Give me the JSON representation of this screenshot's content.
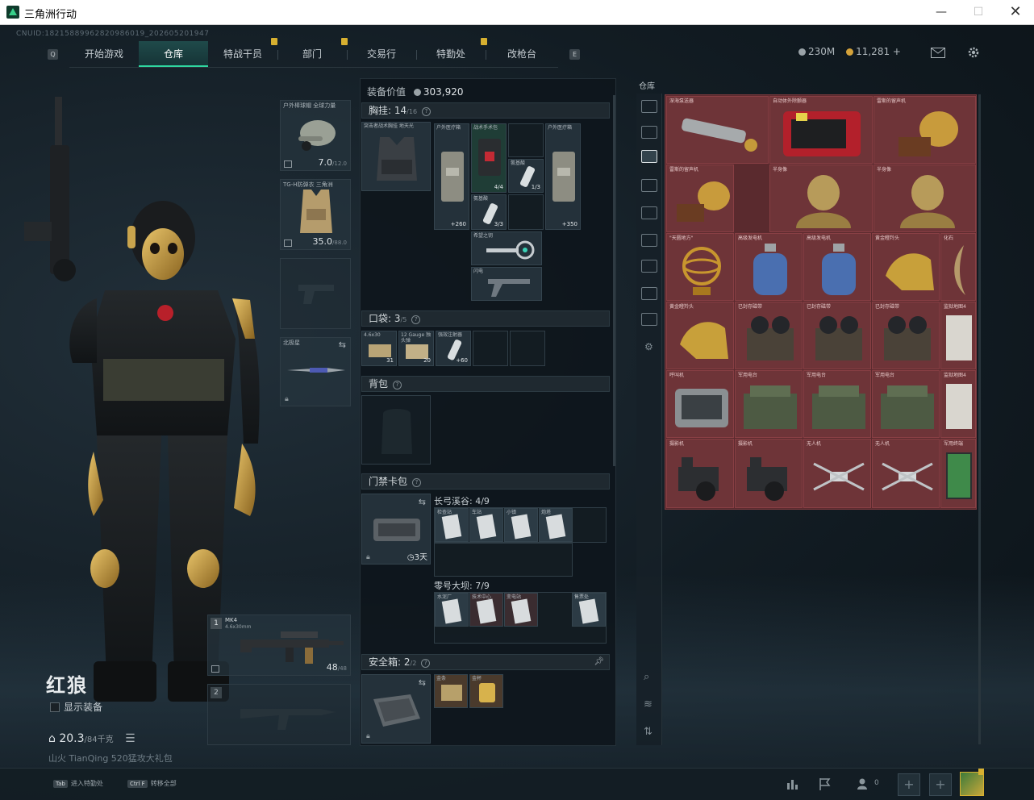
{
  "window": {
    "title": "三角洲行动"
  },
  "cnuid": "CNUID:18215889962820986019_202605201947",
  "nav": {
    "tabs": [
      "开始游戏",
      "仓库",
      "特战干员",
      "部门",
      "交易行",
      "特勤处",
      "改枪台"
    ],
    "active": "仓库",
    "left_key": "Q",
    "right_key": "E"
  },
  "currency": {
    "coins": "230M",
    "bonds": "11,281 +"
  },
  "colors": {
    "accent": "#2fd6a0",
    "stash_bg": "#5a2a2e",
    "badge": "#d7b030"
  },
  "operator": {
    "name": "红狼",
    "show_equipment": "显示装备",
    "weight": "20.3",
    "weight_max": "/84千克",
    "friend_line": "山火 TianQing 520猛攻大礼包"
  },
  "gear": {
    "helmet": {
      "name": "户外棒球帽 全球力量",
      "value": "7.0",
      "max": "/12.0"
    },
    "armor": {
      "name": "TG-H防弹衣 三角洲",
      "value": "35.0",
      "max": "/88.0"
    },
    "knife": {
      "name": "北极星"
    },
    "primary": {
      "name": "MK4",
      "caliber": "4.6x30mm",
      "ammo": "48",
      "ammo_max": "/48",
      "slot": "1"
    },
    "secondary": {
      "slot": "2"
    }
  },
  "mid": {
    "equip_value_label": "装备价值",
    "equip_value": "303,920",
    "chest": {
      "title": "胸挂:",
      "count": "14",
      "max": "/16",
      "rig": "突击者战术胸挂 地天光"
    },
    "chest_items": [
      {
        "label": "户外医疗箱",
        "val": "+260"
      },
      {
        "label": "战术手术包",
        "val": "4/4"
      },
      {
        "label": "氨基酸",
        "val": "1/3"
      },
      {
        "label": "户外医疗箱",
        "val": "+350"
      },
      {
        "label": "氨基酸",
        "val": "3/3"
      },
      {
        "label": "希望之钥",
        "val": ""
      },
      {
        "label": "闪电",
        "val": ""
      }
    ],
    "pocket": {
      "title": "口袋:",
      "count": "3",
      "max": "/5"
    },
    "pocket_items": [
      {
        "label": "4.6x30",
        "val": "31"
      },
      {
        "label": "12 Gauge 独头弹",
        "val": "20"
      },
      {
        "label": "强效注射器",
        "val": "+60"
      }
    ],
    "backpack": {
      "title": "背包"
    },
    "keycard": {
      "title": "门禁卡包",
      "days": "3天"
    },
    "keys_zones": [
      {
        "name": "长弓溪谷:",
        "count": "4/9",
        "items": [
          "检查站",
          "车站",
          "小镇",
          "炮塔"
        ]
      },
      {
        "name": "零号大坝:",
        "count": "7/9",
        "items": [
          "水泥厂",
          "技术中心",
          "变电站",
          "售票处"
        ]
      }
    ],
    "safebox": {
      "title": "安全箱:",
      "count": "2",
      "max": "/2",
      "items": [
        "金条",
        "金杯"
      ]
    }
  },
  "stash": {
    "title": "仓库",
    "items": [
      {
        "label": "深海泵送器"
      },
      {
        "label": "自动体外除颤器"
      },
      {
        "label": "雷斯的留声机"
      },
      {
        "label": "雷斯的留声机"
      },
      {
        "label": "半身像"
      },
      {
        "label": "半身像"
      },
      {
        "label": "\"天圆地方\""
      },
      {
        "label": "高级发电机"
      },
      {
        "label": "高级发电机"
      },
      {
        "label": "黄金瞪羚头"
      },
      {
        "label": "化石"
      },
      {
        "label": "黄金瞪羚头"
      },
      {
        "label": "已封存磁带"
      },
      {
        "label": "已封存磁带"
      },
      {
        "label": "已封存磁带"
      },
      {
        "label": "监狱地图4"
      },
      {
        "label": "呼叫机"
      },
      {
        "label": "军用电台"
      },
      {
        "label": "军用电台"
      },
      {
        "label": "军用电台"
      },
      {
        "label": "监狱地图4"
      },
      {
        "label": "摄影机"
      },
      {
        "label": "摄影机"
      },
      {
        "label": "无人机"
      },
      {
        "label": "无人机"
      },
      {
        "label": "军用终端"
      }
    ]
  },
  "bottom": {
    "hints": [
      {
        "key": "Tab",
        "text": "进入特勤处"
      },
      {
        "key": "Ctrl F",
        "text": "转移全部"
      }
    ],
    "friends_count": "0"
  }
}
